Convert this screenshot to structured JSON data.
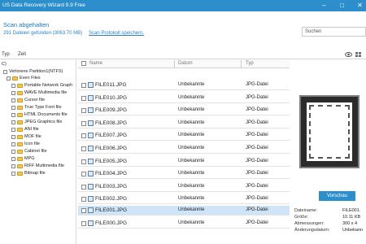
{
  "window": {
    "title": "US Data Recovery Wizard 9.9 Free",
    "controls": [
      "minimize",
      "maximize",
      "close"
    ]
  },
  "status": {
    "headline": "Scan abgehalten",
    "summary": "291 Dateien gefunden (3063.70 MB)",
    "save_link": "Scan Protokoll speichern."
  },
  "search": {
    "placeholder": "Suchen"
  },
  "toolbar": {
    "tabs": [
      "Typ",
      "Zeit"
    ],
    "icons": [
      "eye-icon",
      "grid-icon",
      "list-icon"
    ]
  },
  "tree": {
    "root": "C)",
    "items": [
      "Verlorene Partition1(NTFS)",
      "Even Files",
      "Portable Network Graph",
      "WAVE Multimedia file",
      "Cursor file",
      "True Type Font file",
      "HTML Documents file",
      "JPEG Graphics file",
      "ANI file",
      "MOF file",
      "Icon file",
      "Cabinet file",
      "MPG",
      "RIFF Multimedia file",
      "Bitmap file"
    ]
  },
  "list": {
    "columns": {
      "name": "Name",
      "date": "Datum",
      "type": "Typ"
    },
    "rows": [
      {
        "name": "FILE011.JPG",
        "date": "Unbekannte",
        "type": "JPG-Datei"
      },
      {
        "name": "FILE010.JPG",
        "date": "Unbekannte",
        "type": "JPG-Datei"
      },
      {
        "name": "FILE009.JPG",
        "date": "Unbekannte",
        "type": "JPG-Datei"
      },
      {
        "name": "FILE008.JPG",
        "date": "Unbekannte",
        "type": "JPG-Datei"
      },
      {
        "name": "FILE007.JPG",
        "date": "Unbekannte",
        "type": "JPG-Datei"
      },
      {
        "name": "FILE006.JPG",
        "date": "Unbekannte",
        "type": "JPG-Datei"
      },
      {
        "name": "FILE005.JPG",
        "date": "Unbekannte",
        "type": "JPG-Datei"
      },
      {
        "name": "FILE004.JPG",
        "date": "Unbekannte",
        "type": "JPG-Datei"
      },
      {
        "name": "FILE003.JPG",
        "date": "Unbekannte",
        "type": "JPG-Datei"
      },
      {
        "name": "FILE002.JPG",
        "date": "Unbekannte",
        "type": "JPG-Datei"
      },
      {
        "name": "FILE001.JPG",
        "date": "Unbekannte",
        "type": "JPG-Datei"
      },
      {
        "name": "FILE000.JPG",
        "date": "Unbekannte",
        "type": "JPG-Datei"
      }
    ],
    "selected_index": 10
  },
  "preview": {
    "button_label": "Vorschau",
    "meta": [
      {
        "key": "Dateiname:",
        "value": "FILE001."
      },
      {
        "key": "Größe:",
        "value": "10.11 KB"
      },
      {
        "key": "Abmessungen:",
        "value": "300 x 4"
      },
      {
        "key": "Änderungsdatum:",
        "value": "Unbekann"
      }
    ]
  },
  "colors": {
    "accent": "#2c8fcb",
    "selection": "#cfe4f7",
    "link": "#2e82c4",
    "folder": "#f2c94c"
  }
}
